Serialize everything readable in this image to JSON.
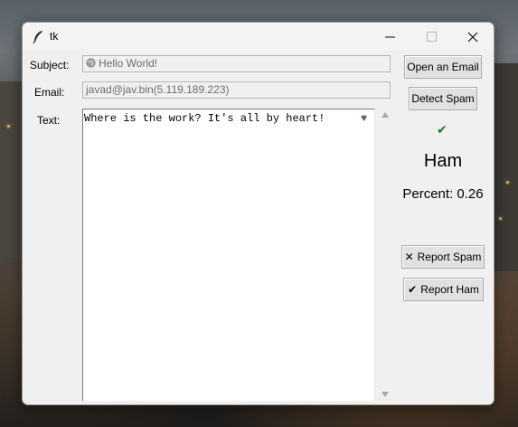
{
  "window": {
    "title": "tk",
    "controls": {
      "minimize": "—",
      "maximize": "☐",
      "close": "✕"
    }
  },
  "form": {
    "subject_label": "Subject:",
    "subject_value": "Hello World!",
    "subject_icon": "globe-icon",
    "email_label": "Email:",
    "email_value": "javad@jav.bin(5.119.189.223)",
    "text_label": "Text:",
    "text_value": "Where is the work? It's all by heart!",
    "text_emoji": "♥"
  },
  "actions": {
    "open_email": "Open an Email",
    "detect_spam": "Detect Spam",
    "report_spam": "Report Spam",
    "report_spam_glyph": "✕",
    "report_ham": "Report Ham",
    "report_ham_glyph": "✔"
  },
  "result": {
    "check_glyph": "✔",
    "check_color": "#1e7a1e",
    "label": "Ham",
    "percent": "Percent: 0.26"
  }
}
